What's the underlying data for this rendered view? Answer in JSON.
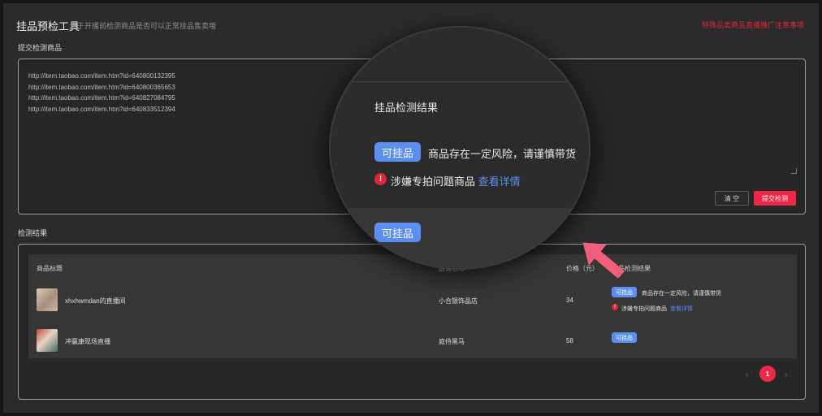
{
  "header": {
    "title": "挂品预检工具",
    "subtitle": "请于开播前检测商品是否可以正常挂品售卖哦",
    "top_link": "特殊品类商品直播推广注意事项"
  },
  "submit_section": {
    "label": "提交检测商品",
    "urls": [
      "http://item.taobao.com/item.htm?id=640800132395",
      "http://item.taobao.com/item.htm?id=640800365653",
      "http://item.taobao.com/item.htm?id=640827084795",
      "http://item.taobao.com/item.htm?id=640833512394"
    ],
    "clear_label": "清 空",
    "submit_label": "提交检测"
  },
  "result_section": {
    "label": "检测结果",
    "columns": [
      "商品标题",
      "店铺名称",
      "价格（元）",
      "挂品检测结果"
    ],
    "rows": [
      {
        "title": "xhxhwmdan的直播间",
        "shop": "小合银饰品店",
        "price": "34",
        "tag": "可挂品",
        "risk_text": "商品存在一定风险，请谨慎带货",
        "issue_text": "涉嫌专拍问题商品",
        "issue_link": "查看详情"
      },
      {
        "title": "冲赢康现场直播",
        "shop": "庭侍黑马",
        "price": "58",
        "tag": "可挂品"
      }
    ]
  },
  "pagination": {
    "current_page": "1",
    "prev_icon": "‹",
    "next_icon": "›"
  },
  "magnifier": {
    "title": "挂品检测结果",
    "tag": "可挂品",
    "risk_text": "商品存在一定风险，请谨慎带货",
    "warn_glyph": "!",
    "issue_text": "涉嫌专拍问题商品",
    "issue_link": "查看详情",
    "lower_tag": "可挂品"
  },
  "colors": {
    "accent_red": "#ee2747",
    "tag_blue": "#5b8ff4",
    "arrow_pink": "#f0607a"
  }
}
